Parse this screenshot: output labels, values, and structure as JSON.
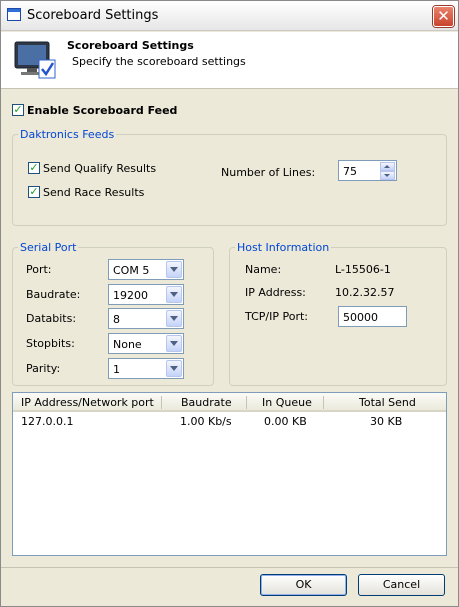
{
  "window": {
    "title": "Scoreboard Settings"
  },
  "header": {
    "title": "Scoreboard Settings",
    "subtitle": "Specify the scoreboard settings"
  },
  "enable_feed": {
    "label": "Enable Scoreboard Feed",
    "checked": true
  },
  "daktronics": {
    "legend": "Daktronics Feeds",
    "send_qualify": {
      "label": "Send Qualify Results",
      "checked": true
    },
    "send_race": {
      "label": "Send Race Results",
      "checked": true
    },
    "lines_label": "Number of Lines:",
    "lines_value": "75"
  },
  "serial": {
    "legend": "Serial Port",
    "fields": [
      {
        "label": "Port:",
        "value": "COM 5"
      },
      {
        "label": "Baudrate:",
        "value": "19200"
      },
      {
        "label": "Databits:",
        "value": "8"
      },
      {
        "label": "Stopbits:",
        "value": "None"
      },
      {
        "label": "Parity:",
        "value": "1"
      }
    ]
  },
  "host": {
    "legend": "Host Information",
    "name_label": "Name:",
    "name_value": "L-15506-1",
    "ip_label": "IP Address:",
    "ip_value": "10.2.32.57",
    "port_label": "TCP/IP Port:",
    "port_value": "50000"
  },
  "table": {
    "columns": [
      "IP Address/Network port",
      "Baudrate",
      "In Queue",
      "Total Send"
    ],
    "rows": [
      [
        "127.0.0.1",
        "1.00 Kb/s",
        "0.00 KB",
        "30 KB"
      ]
    ]
  },
  "buttons": {
    "ok": "OK",
    "cancel": "Cancel"
  },
  "colors": {
    "group_legend": "#0046d5",
    "dialog_bg": "#ece9d8",
    "check": "#21a121"
  }
}
